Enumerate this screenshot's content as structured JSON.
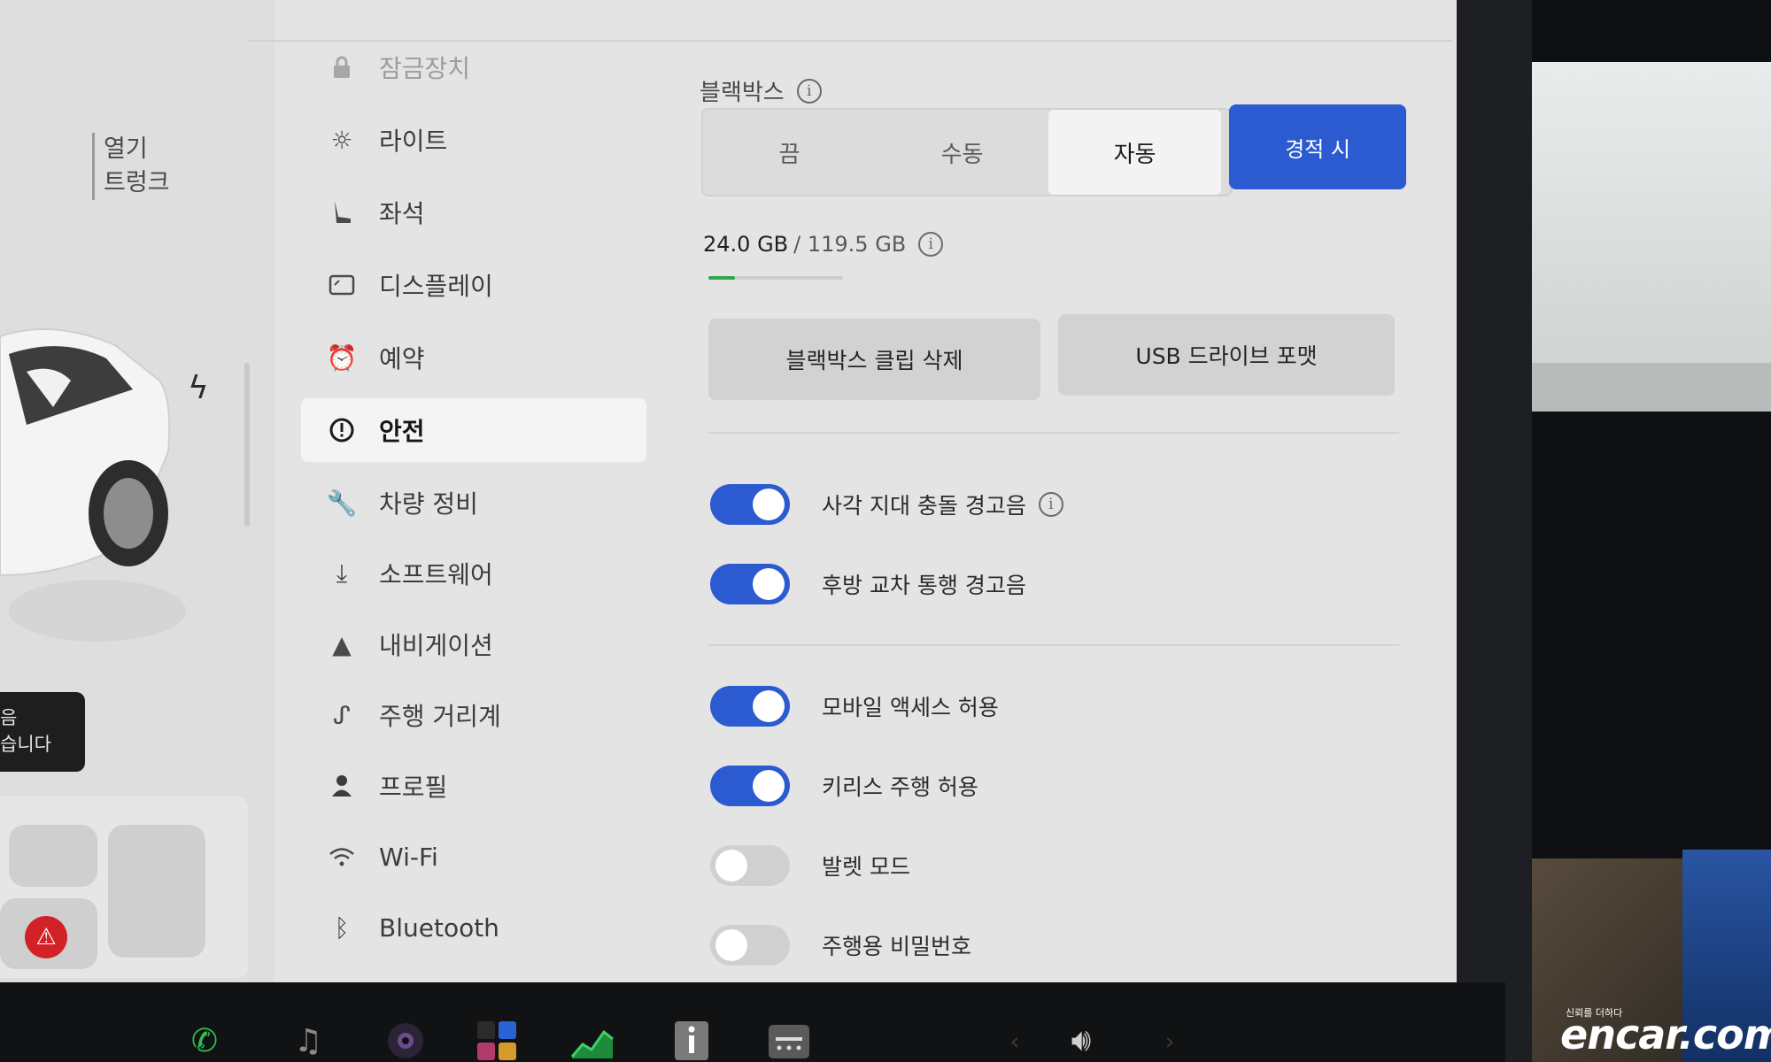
{
  "car": {
    "open_label": "열기",
    "trunk_label": "트렁크",
    "notice_line1": "음",
    "notice_line2": "습니다"
  },
  "nav": {
    "items": [
      {
        "label": "잠금장치",
        "icon": "lock-icon"
      },
      {
        "label": "라이트",
        "icon": "light-icon"
      },
      {
        "label": "좌석",
        "icon": "seat-icon"
      },
      {
        "label": "디스플레이",
        "icon": "display-icon"
      },
      {
        "label": "예약",
        "icon": "alarm-clock-icon"
      },
      {
        "label": "안전",
        "icon": "alert-circle-icon"
      },
      {
        "label": "차량 정비",
        "icon": "wrench-icon"
      },
      {
        "label": "소프트웨어",
        "icon": "download-icon"
      },
      {
        "label": "내비게이션",
        "icon": "navigation-arrow-icon"
      },
      {
        "label": "주행 거리계",
        "icon": "trip-icon"
      },
      {
        "label": "프로필",
        "icon": "person-icon"
      },
      {
        "label": "Wi-Fi",
        "icon": "wifi-icon"
      },
      {
        "label": "Bluetooth",
        "icon": "bluetooth-icon"
      }
    ],
    "active": "안전"
  },
  "dashcam": {
    "title": "블랙박스",
    "options": [
      "끔",
      "수동",
      "자동",
      "경적 시"
    ],
    "selected": "자동",
    "used": "24.0 GB",
    "total": "/ 119.5 GB",
    "usage_fraction": 0.2,
    "delete_clips_label": "블랙박스 클립 삭제",
    "format_usb_label": "USB 드라이브 포맷"
  },
  "toggles": [
    {
      "label": "사각 지대 충돌 경고음",
      "on": true,
      "info": true
    },
    {
      "label": "후방 교차 통행 경고음",
      "on": true,
      "info": false
    },
    {
      "label": "모바일 액세스 허용",
      "on": true,
      "info": false
    },
    {
      "label": "키리스 주행 허용",
      "on": true,
      "info": false
    },
    {
      "label": "발렛 모드",
      "on": false,
      "info": false
    },
    {
      "label": "주행용 비밀번호",
      "on": false,
      "info": false
    }
  ],
  "watermark": {
    "brand": "encar.com",
    "tagline": "신뢰를 더하다"
  },
  "colors": {
    "accent": "#2c5ad0",
    "progress": "#2ea84a",
    "alert": "#d32128"
  }
}
